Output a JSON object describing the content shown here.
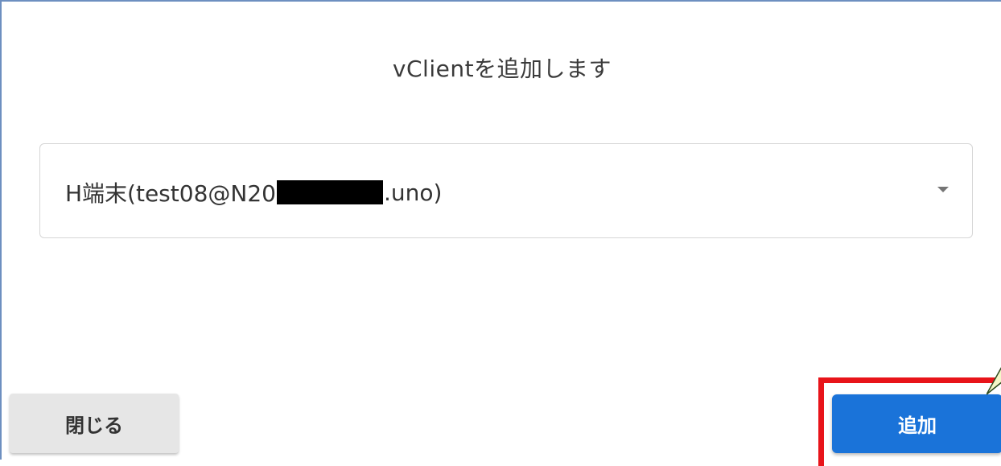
{
  "dialog": {
    "title": "vClientを追加します"
  },
  "client_select": {
    "value_prefix": "H端末(test08@N20",
    "value_suffix": ".uno)"
  },
  "buttons": {
    "close_label": "閉じる",
    "add_label": "追加"
  },
  "colors": {
    "primary": "#1a73d9",
    "highlight": "#e8141a",
    "secondary_button": "#e6e6e6"
  },
  "icons": {
    "select_caret": "caret-down-icon"
  }
}
